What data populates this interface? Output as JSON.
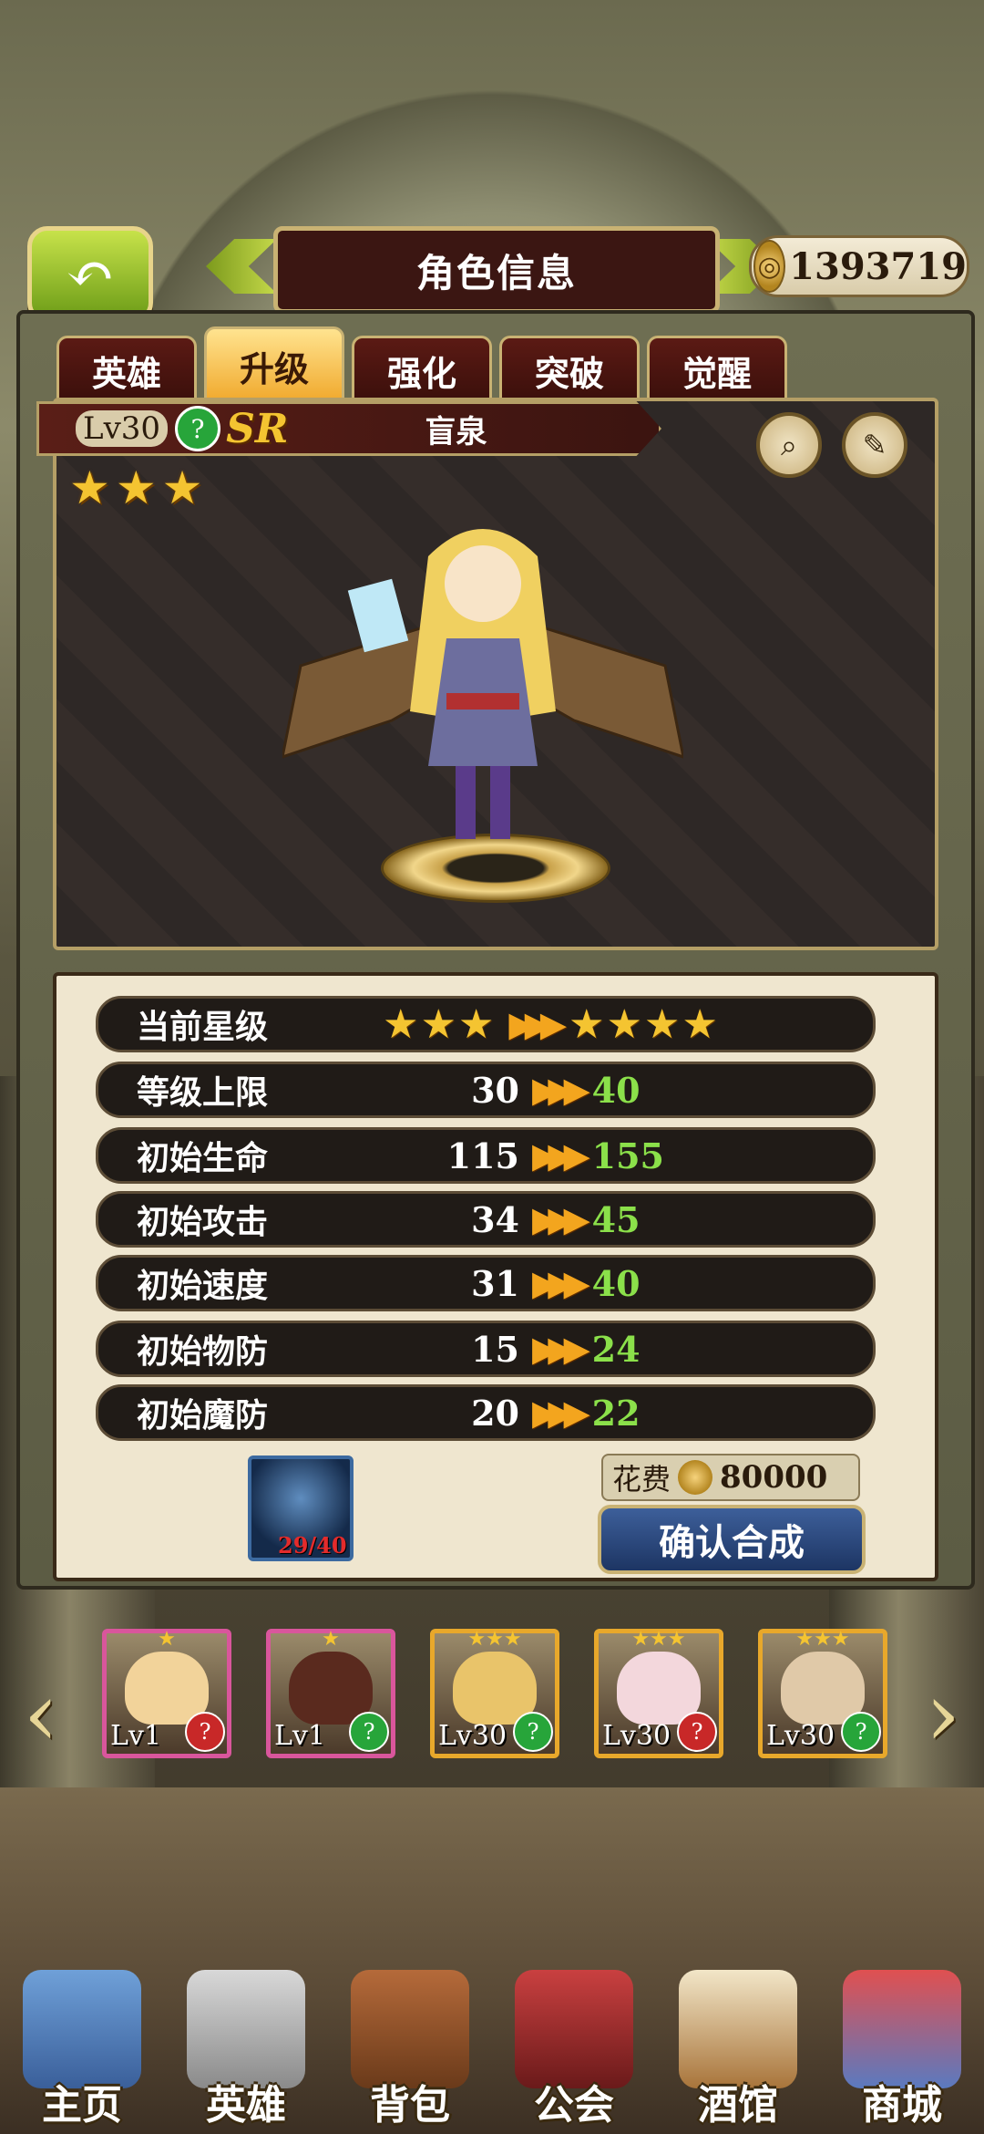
{
  "header": {
    "title": "角色信息",
    "coins": "1393719"
  },
  "tabs": [
    {
      "label": "英雄",
      "active": false
    },
    {
      "label": "升级",
      "active": true
    },
    {
      "label": "强化",
      "active": false
    },
    {
      "label": "突破",
      "active": false
    },
    {
      "label": "觉醒",
      "active": false
    }
  ],
  "hero": {
    "level": "Lv30",
    "rarity": "SR",
    "name": "盲泉",
    "stars": 3
  },
  "stats": [
    {
      "label": "当前星级",
      "current": "",
      "next": ""
    },
    {
      "label": "等级上限",
      "current": "30",
      "next": "40"
    },
    {
      "label": "初始生命",
      "current": "115",
      "next": "155"
    },
    {
      "label": "初始攻击",
      "current": "34",
      "next": "45"
    },
    {
      "label": "初始速度",
      "current": "31",
      "next": "40"
    },
    {
      "label": "初始物防",
      "current": "15",
      "next": "24"
    },
    {
      "label": "初始魔防",
      "current": "20",
      "next": "22"
    }
  ],
  "star_upgrade": {
    "from": 3,
    "to": 4
  },
  "material": {
    "count": "29/40"
  },
  "cost": {
    "label": "花费",
    "value": "80000"
  },
  "confirm_label": "确认合成",
  "roster": [
    {
      "level": "Lv1",
      "stars": 1,
      "frame_color": "#d9569c",
      "attr_color": "#c82828",
      "face_color": "#f2d39a"
    },
    {
      "level": "Lv1",
      "stars": 1,
      "frame_color": "#d9569c",
      "attr_color": "#27a53a",
      "face_color": "#5a2a1e"
    },
    {
      "level": "Lv30",
      "stars": 3,
      "frame_color": "#e8a82b",
      "attr_color": "#27a53a",
      "face_color": "#e9c46a"
    },
    {
      "level": "Lv30",
      "stars": 3,
      "frame_color": "#e8a82b",
      "attr_color": "#c82828",
      "face_color": "#f3d7dc"
    },
    {
      "level": "Lv30",
      "stars": 3,
      "frame_color": "#e8a82b",
      "attr_color": "#27a53a",
      "face_color": "#e0c9a8"
    }
  ],
  "nav": [
    {
      "label": "主页",
      "icon": "castle-icon"
    },
    {
      "label": "英雄",
      "icon": "helmet-icon"
    },
    {
      "label": "背包",
      "icon": "backpack-icon"
    },
    {
      "label": "公会",
      "icon": "shield-icon"
    },
    {
      "label": "酒馆",
      "icon": "beer-mug-icon"
    },
    {
      "label": "商城",
      "icon": "shop-icon"
    }
  ]
}
